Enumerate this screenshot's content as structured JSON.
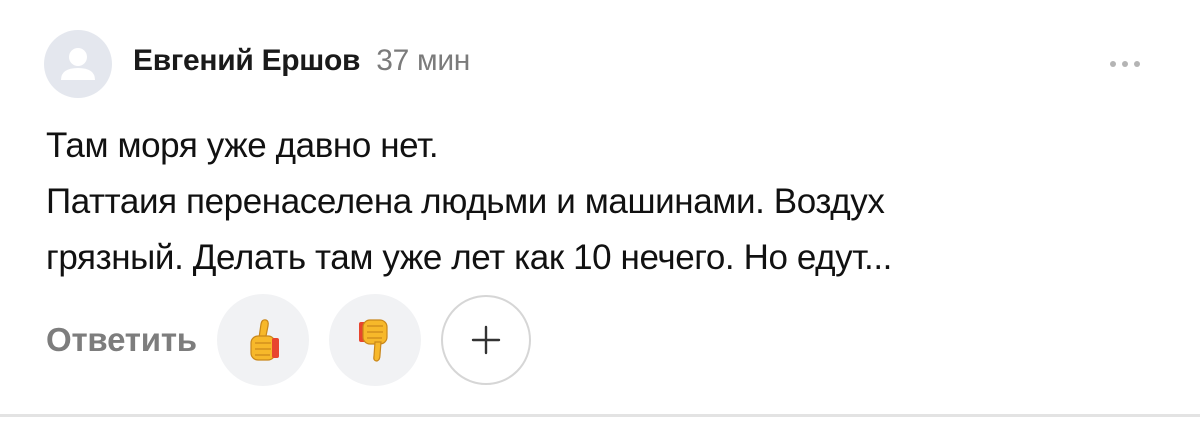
{
  "comment": {
    "author": "Евгений Ершов",
    "time": "37 мин",
    "avatar_icon": "user-placeholder-icon",
    "more_icon": "more-dots-icon",
    "lines": [
      "Там моря уже давно нет.",
      "Паттаия перенаселена людьми и машинами. Воздух",
      "грязный. Делать там уже лет как 10 нечего. Но едут..."
    ],
    "actions": {
      "reply_label": "Ответить",
      "like_icon": "thumbs-up-icon",
      "dislike_icon": "thumbs-down-icon",
      "add_reaction_icon": "plus-icon"
    }
  },
  "colors": {
    "author": "#1a1a1a",
    "time": "#7b7b7b",
    "reply": "#7d7d7d",
    "reaction_bg": "#f1f2f4",
    "thumb_yellow": "#f7b82a",
    "thumb_cuff": "#e8452e"
  }
}
